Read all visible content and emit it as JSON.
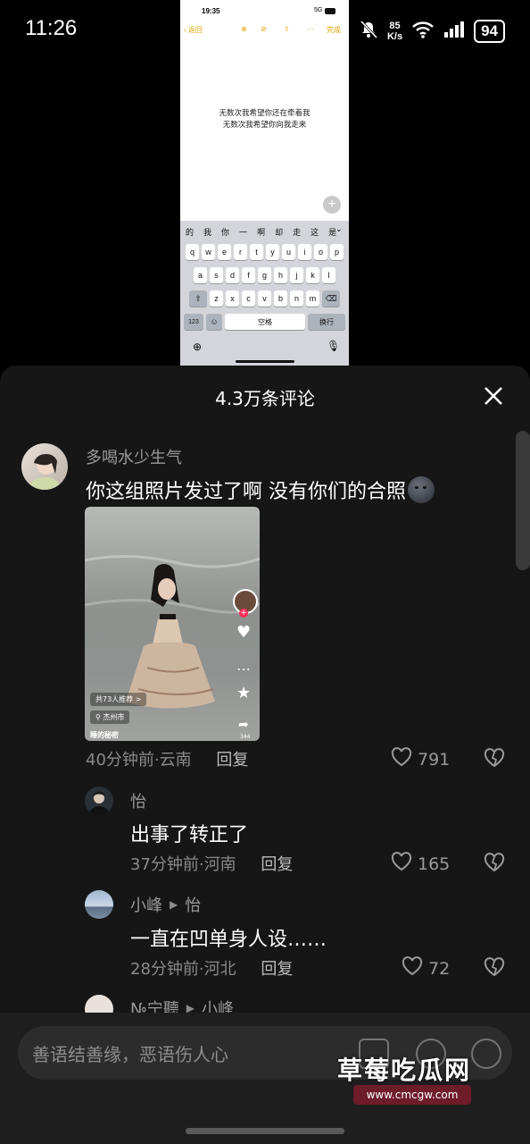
{
  "status_bar": {
    "time": "11:26",
    "net_speed_value": "85",
    "net_speed_unit": "K/s",
    "battery": "94"
  },
  "embedded_screenshot": {
    "time": "19:35",
    "network": "5G",
    "back_label": "返回",
    "done_label": "完成",
    "note_lines": [
      "无数次我希望你还在牵着我",
      "无数次我希望你向我走来"
    ],
    "candidates": [
      "的",
      "我",
      "你",
      "一",
      "啊",
      "却",
      "走",
      "这",
      "是"
    ],
    "row1": [
      "q",
      "w",
      "e",
      "r",
      "t",
      "y",
      "u",
      "i",
      "o",
      "p"
    ],
    "row2": [
      "a",
      "s",
      "d",
      "f",
      "g",
      "h",
      "j",
      "k",
      "l"
    ],
    "row3": [
      "z",
      "x",
      "c",
      "v",
      "b",
      "n",
      "m"
    ],
    "key_123": "123",
    "space_label": "空格",
    "return_label": "换行"
  },
  "sheet": {
    "title": "4.3万条评论",
    "comments": [
      {
        "user": "多喝水少生气",
        "text": "你这组照片发过了啊  没有你们的合照",
        "time_loc": "40分钟前·云南",
        "reply": "回复",
        "likes": "791"
      },
      {
        "user": "怡",
        "text": "出事了转正了",
        "time_loc": "37分钟前·河南",
        "reply": "回复",
        "likes": "165"
      },
      {
        "user": "小峰",
        "reply_to": "怡",
        "text": "一直在凹单身人设……",
        "time_loc": "28分钟前·河北",
        "reply": "回复",
        "likes": "72"
      },
      {
        "user": "№宁聽",
        "reply_to": "小峰"
      }
    ],
    "photo": {
      "share_badge": "共73人推荐 >",
      "location": "杰州市",
      "caption": "睡的秘密",
      "count": "344"
    }
  },
  "bottom": {
    "placeholder": "善语结善缘，恶语伤人心"
  },
  "watermark": {
    "text": "草莓吃瓜网",
    "url": "www.cmcgw.com"
  },
  "colors": {
    "sheet_bg": "#161616",
    "accent_yellow": "#d9a400",
    "watermark_bg": "#6e1b2a"
  }
}
